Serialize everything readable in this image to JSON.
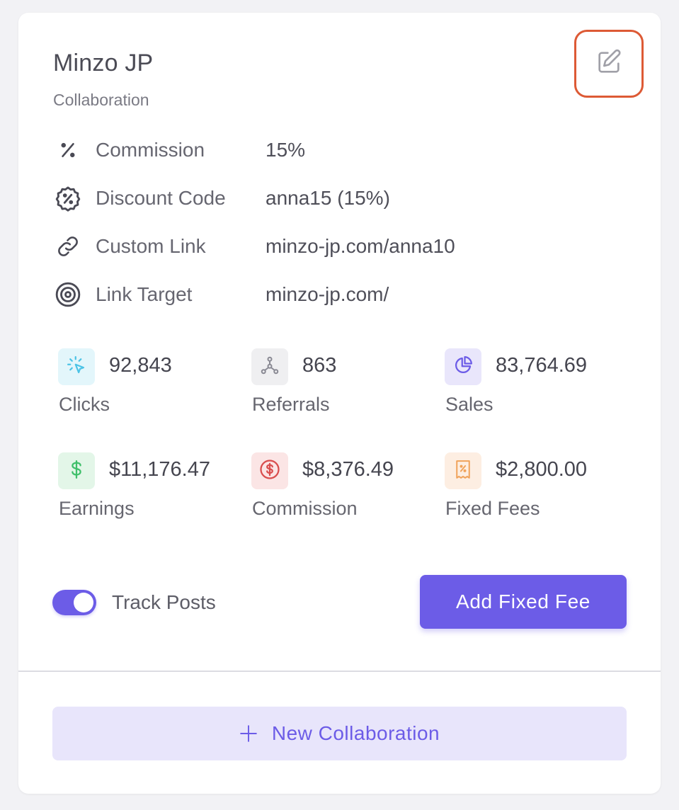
{
  "header": {
    "title": "Minzo JP",
    "subtitle": "Collaboration",
    "edit_icon": "pencil-square-icon"
  },
  "info": [
    {
      "icon": "percent-icon",
      "label": "Commission",
      "value": "15%"
    },
    {
      "icon": "discount-badge-icon",
      "label": "Discount Code",
      "value": "anna15 (15%)"
    },
    {
      "icon": "link-icon",
      "label": "Custom Link",
      "value": "minzo-jp.com/anna10"
    },
    {
      "icon": "target-icon",
      "label": "Link Target",
      "value": "minzo-jp.com/"
    }
  ],
  "stats": [
    {
      "icon": "cursor-click-icon",
      "value": "92,843",
      "label": "Clicks",
      "bg": "#e3f6fb",
      "fg": "#4cc3e6"
    },
    {
      "icon": "share-nodes-icon",
      "value": "863",
      "label": "Referrals",
      "bg": "#efeff1",
      "fg": "#8a8a94"
    },
    {
      "icon": "pie-chart-icon",
      "value": "83,764.69",
      "label": "Sales",
      "bg": "#e9e6fb",
      "fg": "#6c5ce7"
    },
    {
      "icon": "dollar-icon",
      "value": "$11,176.47",
      "label": "Earnings",
      "bg": "#e3f6e8",
      "fg": "#3fbf6a"
    },
    {
      "icon": "dollar-circle-icon",
      "value": "$8,376.49",
      "label": "Commission",
      "bg": "#fbe5e5",
      "fg": "#d94d4d"
    },
    {
      "icon": "receipt-percent-icon",
      "value": "$2,800.00",
      "label": "Fixed Fees",
      "bg": "#fdeee2",
      "fg": "#f0a35b"
    }
  ],
  "track_posts": {
    "label": "Track Posts",
    "enabled": true
  },
  "add_fixed_fee": {
    "label": "Add Fixed Fee"
  },
  "new_collaboration": {
    "label": "New Collaboration"
  },
  "colors": {
    "accent": "#6c5ce7",
    "edit_highlight": "#dd5a35",
    "accent_light": "#e8e5fb"
  }
}
